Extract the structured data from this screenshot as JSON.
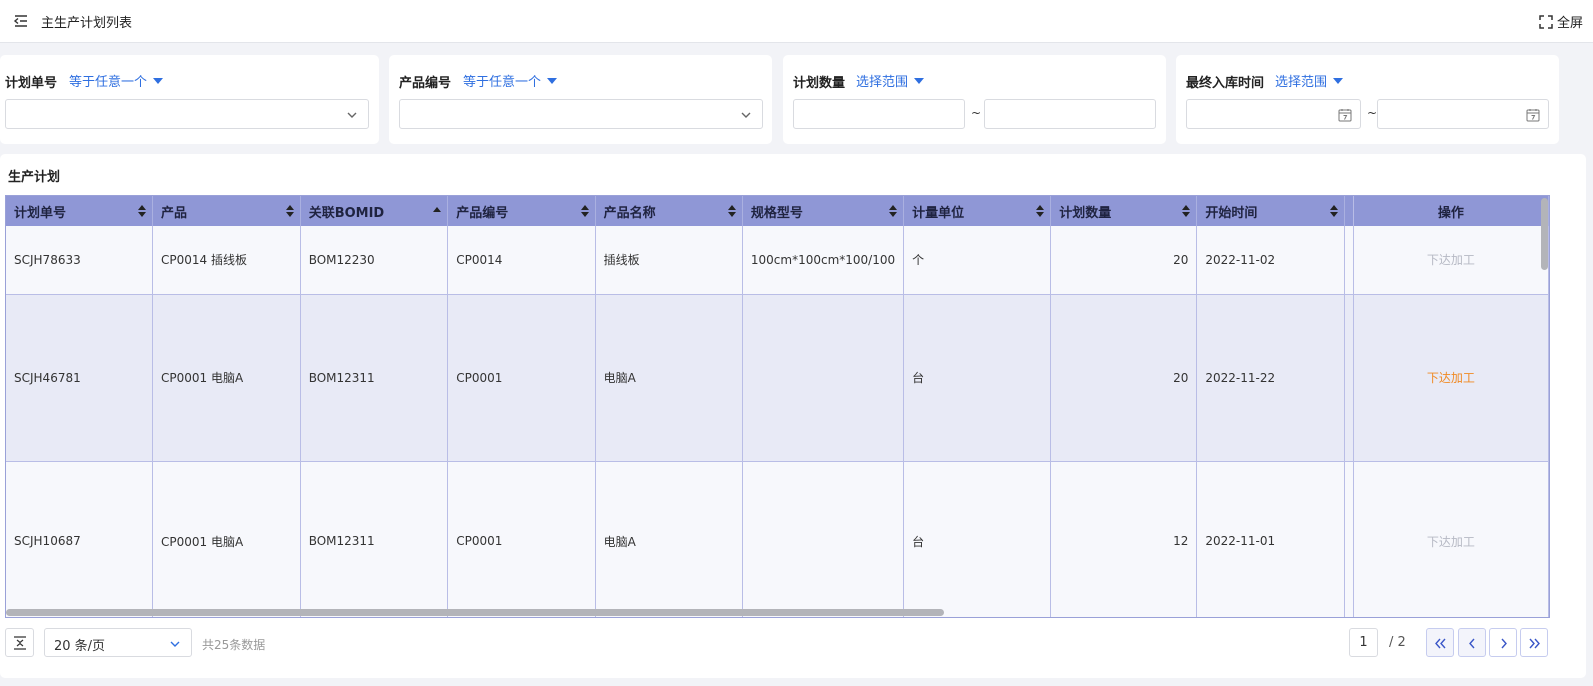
{
  "header": {
    "title": "主生产计划列表",
    "fullscreen_label": "全屏"
  },
  "filters": [
    {
      "label": "计划单号",
      "operator": "等于任意一个"
    },
    {
      "label": "产品编号",
      "operator": "等于任意一个"
    },
    {
      "label": "计划数量",
      "operator": "选择范围",
      "separator": "~"
    },
    {
      "label": "最终入库时间",
      "operator": "选择范围",
      "separator": "~"
    }
  ],
  "table": {
    "section_title": "生产计划",
    "columns": [
      "计划单号",
      "产品",
      "关联BOMID",
      "产品编号",
      "产品名称",
      "规格型号",
      "计量单位",
      "计划数量",
      "开始时间",
      "操作"
    ],
    "rows": [
      {
        "plan_no": "SCJH78633",
        "product": "CP0014 插线板",
        "bom_id": "BOM12230",
        "product_code": "CP0014",
        "product_name": "插线板",
        "spec": "100cm*100cm*100/100",
        "unit": "个",
        "qty": "20",
        "start": "2022-11-02",
        "action": "下达加工",
        "action_enabled": false
      },
      {
        "plan_no": "SCJH46781",
        "product": "CP0001 电脑A",
        "bom_id": "BOM12311",
        "product_code": "CP0001",
        "product_name": "电脑A",
        "spec": "",
        "unit": "台",
        "qty": "20",
        "start": "2022-11-22",
        "action": "下达加工",
        "action_enabled": true
      },
      {
        "plan_no": "SCJH10687",
        "product": "CP0001 电脑A",
        "bom_id": "BOM12311",
        "product_code": "CP0001",
        "product_name": "电脑A",
        "spec": "",
        "unit": "台",
        "qty": "12",
        "start": "2022-11-01",
        "action": "下达加工",
        "action_enabled": false
      }
    ]
  },
  "pagination": {
    "page_size": "20 条/页",
    "total": "共25条数据",
    "current_page": "1",
    "total_pages": "/ 2"
  }
}
